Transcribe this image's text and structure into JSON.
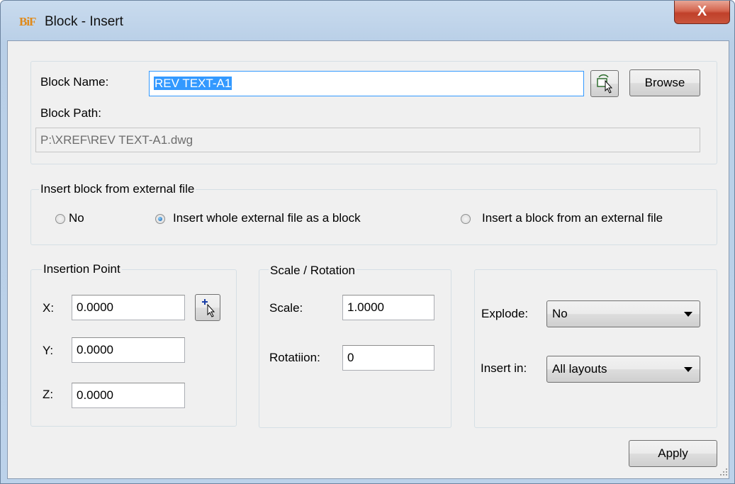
{
  "window": {
    "title": "Block - Insert",
    "app_icon_text": "BiF",
    "close_label": "X"
  },
  "block": {
    "name_label": "Block Name:",
    "name_value": "REV TEXT-A1",
    "path_label": "Block Path:",
    "path_value": "P:\\XREF\\REV TEXT-A1.dwg",
    "browse_label": "Browse",
    "pick_icon": "select-block-icon"
  },
  "external": {
    "legend": "Insert block from external file",
    "options": [
      {
        "label": "No",
        "checked": false
      },
      {
        "label": "Insert whole external file as a block",
        "checked": true
      },
      {
        "label": "Insert a block from an external file",
        "checked": false
      }
    ]
  },
  "insertion": {
    "legend": "Insertion Point",
    "x_label": "X:",
    "x_value": "0.0000",
    "y_label": "Y:",
    "y_value": "0.0000",
    "z_label": "Z:",
    "z_value": "0.0000",
    "pick_icon": "pick-point-icon"
  },
  "scale_rotation": {
    "legend": "Scale / Rotation",
    "scale_label": "Scale:",
    "scale_value": "1.0000",
    "rotation_label": "Rotatiion:",
    "rotation_value": "0"
  },
  "options": {
    "explode_label": "Explode:",
    "explode_value": "No",
    "insert_in_label": "Insert in:",
    "insert_in_value": "All layouts"
  },
  "footer": {
    "apply_label": "Apply"
  }
}
